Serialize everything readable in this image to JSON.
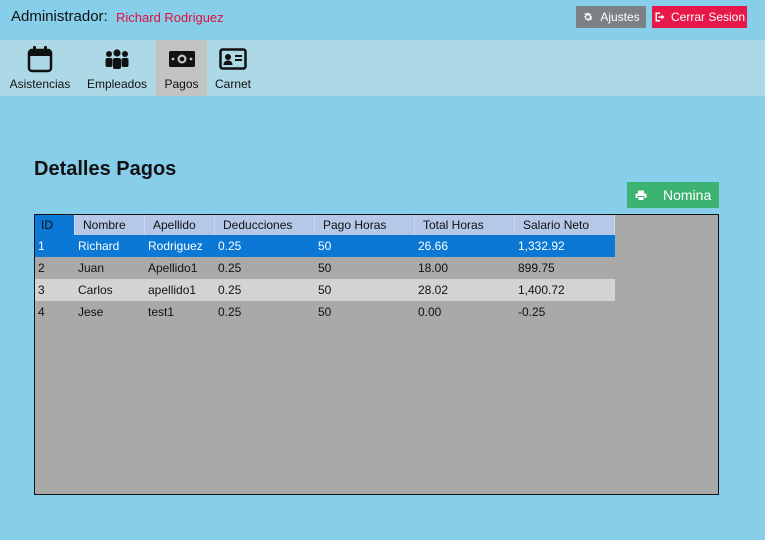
{
  "header": {
    "admin_label": "Administrador:",
    "admin_name": "Richard Rodriguez",
    "settings_label": "Ajustes",
    "logout_label": "Cerrar Sesion"
  },
  "nav": {
    "items": [
      {
        "label": "Asistencias",
        "icon": "calendar-icon"
      },
      {
        "label": "Empleados",
        "icon": "users-icon"
      },
      {
        "label": "Pagos",
        "icon": "money-icon",
        "active": true
      },
      {
        "label": "Carnet",
        "icon": "id-card-icon"
      }
    ]
  },
  "main": {
    "title": "Detalles Pagos",
    "nomina_label": "Nomina"
  },
  "table": {
    "columns": [
      "ID",
      "Nombre",
      "Apellido",
      "Deducciones",
      "Pago Horas",
      "Total Horas",
      "Salario Neto"
    ],
    "rows": [
      [
        "1",
        "Richard",
        "Rodriguez",
        "0.25",
        "50",
        "26.66",
        "1,332.92"
      ],
      [
        "2",
        "Juan",
        "Apellido1",
        "0.25",
        "50",
        "18.00",
        "899.75"
      ],
      [
        "3",
        "Carlos",
        "apellido1",
        "0.25",
        "50",
        "28.02",
        "1,400.72"
      ],
      [
        "4",
        "Jese",
        "test1",
        "0.25",
        "50",
        "0.00",
        "-0.25"
      ]
    ],
    "selected_row": 0
  },
  "colors": {
    "background": "#87ceeb",
    "nav_background": "#add8e6",
    "selection": "#0a78d4",
    "logout": "#e8174a",
    "nomina": "#3cb371",
    "admin_name": "#e0103c"
  }
}
